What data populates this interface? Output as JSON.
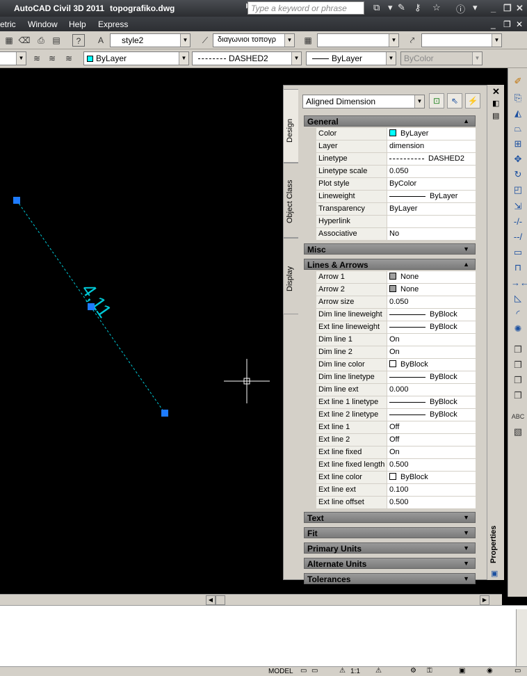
{
  "window": {
    "app": "AutoCAD Civil 3D 2011",
    "file": "topografiko.dwg"
  },
  "search": {
    "placeholder": "Type a keyword or phrase"
  },
  "menu": [
    "etric",
    "Window",
    "Help",
    "Express"
  ],
  "toolbar1": {
    "text_style": "style2",
    "dim_style": "διαγωνιοι τοπογρ",
    "table_style": "",
    "multileader_style": ""
  },
  "toolbar2": {
    "layer_color": "ByLayer",
    "linetype": "DASHED2",
    "lineweight": "ByLayer",
    "plot_style": "ByColor"
  },
  "drawing": {
    "dimension_text": "4,11",
    "colors": {
      "dimension": "#00c8d6",
      "grip": "#1e7bff",
      "crosshair": "#ffffff"
    }
  },
  "properties": {
    "object_type": "Aligned Dimension",
    "tabs": [
      "Design",
      "Object Class",
      "Display"
    ],
    "palette_label": "Properties",
    "sections": [
      {
        "title": "General",
        "expanded": true,
        "rows": [
          {
            "k": "Color",
            "v": "ByLayer",
            "sw": "#00ffff"
          },
          {
            "k": "Layer",
            "v": "dimension"
          },
          {
            "k": "Linetype",
            "v": "DASHED2",
            "dash": true
          },
          {
            "k": "Linetype scale",
            "v": "0.050"
          },
          {
            "k": "Plot style",
            "v": "ByColor"
          },
          {
            "k": "Lineweight",
            "v": "ByLayer",
            "line": true
          },
          {
            "k": "Transparency",
            "v": "ByLayer"
          },
          {
            "k": "Hyperlink",
            "v": ""
          },
          {
            "k": "Associative",
            "v": "No"
          }
        ]
      },
      {
        "title": "Misc",
        "expanded": false,
        "rows": []
      },
      {
        "title": "Lines & Arrows",
        "expanded": true,
        "rows": [
          {
            "k": "Arrow 1",
            "v": "None",
            "sw": "#a0a0a0"
          },
          {
            "k": "Arrow 2",
            "v": "None",
            "sw": "#a0a0a0"
          },
          {
            "k": "Arrow size",
            "v": "0.050"
          },
          {
            "k": "Dim line lineweight",
            "v": "ByBlock",
            "line": true
          },
          {
            "k": "Ext line lineweight",
            "v": "ByBlock",
            "line": true
          },
          {
            "k": "Dim line 1",
            "v": "On"
          },
          {
            "k": "Dim line 2",
            "v": "On"
          },
          {
            "k": "Dim line color",
            "v": "ByBlock",
            "sw": "#ffffff"
          },
          {
            "k": "Dim line linetype",
            "v": "ByBlock",
            "line": true
          },
          {
            "k": "Dim line ext",
            "v": "0.000"
          },
          {
            "k": "Ext line 1 linetype",
            "v": "ByBlock",
            "line": true
          },
          {
            "k": "Ext line 2 linetype",
            "v": "ByBlock",
            "line": true
          },
          {
            "k": "Ext line 1",
            "v": "Off"
          },
          {
            "k": "Ext line 2",
            "v": "Off"
          },
          {
            "k": "Ext line fixed",
            "v": "On"
          },
          {
            "k": "Ext line fixed length",
            "v": "0.500"
          },
          {
            "k": "Ext line color",
            "v": "ByBlock",
            "sw": "#ffffff"
          },
          {
            "k": "Ext line ext",
            "v": "0.100"
          },
          {
            "k": "Ext line offset",
            "v": "0.500"
          }
        ]
      },
      {
        "title": "Text",
        "expanded": false,
        "rows": []
      },
      {
        "title": "Fit",
        "expanded": false,
        "rows": []
      },
      {
        "title": "Primary Units",
        "expanded": false,
        "rows": []
      },
      {
        "title": "Alternate Units",
        "expanded": false,
        "rows": []
      },
      {
        "title": "Tolerances",
        "expanded": false,
        "rows": []
      }
    ]
  },
  "statusbar": {
    "model": "MODEL",
    "scale": "1:1"
  }
}
